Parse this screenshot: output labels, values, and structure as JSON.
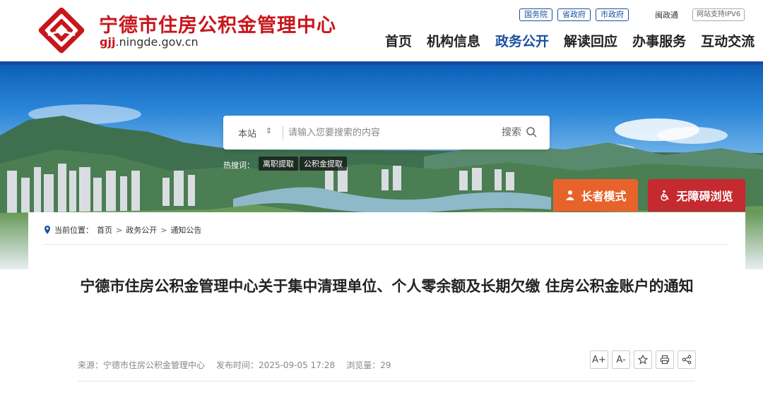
{
  "header": {
    "site_title": "宁德市住房公积金管理中心",
    "domain_prefix": "gjj",
    "domain_rest": ".ningde.gov.cn",
    "top_links": [
      "国务院",
      "省政府",
      "市政府"
    ],
    "mingzheng": "闽政通",
    "ipv6": "网站支持IPV6",
    "nav": [
      "首页",
      "机构信息",
      "政务公开",
      "解读回应",
      "办事服务",
      "互动交流"
    ],
    "nav_active_index": 2,
    "colors": {
      "brand_red": "#c8161d",
      "brand_blue": "#1b4fa0"
    }
  },
  "search": {
    "scope": "本站",
    "placeholder": "请输入您要搜索的内容",
    "button": "搜索",
    "hot_label": "热搜词：",
    "hot_tags": [
      "离职提取",
      "公积金提取"
    ]
  },
  "accessibility": {
    "elder_mode": "长者模式",
    "barrier_free": "无障碍浏览",
    "colors": {
      "elder": "#e8622c",
      "barrier": "#c42a30"
    }
  },
  "breadcrumb": {
    "label": "当前位置：",
    "items": [
      "首页",
      "政务公开",
      "通知公告"
    ]
  },
  "article": {
    "title": "宁德市住房公积金管理中心关于集中清理单位、个人零余额及长期欠缴 住房公积金账户的通知",
    "source_label": "来源：",
    "source": "宁德市住房公积金管理中心",
    "published_label": "发布时间：",
    "published": "2025-09-05 17:28",
    "views_label": "浏览量：",
    "views": "29",
    "tools": [
      "A+",
      "A-",
      "star-icon",
      "print-icon",
      "share-icon"
    ]
  }
}
